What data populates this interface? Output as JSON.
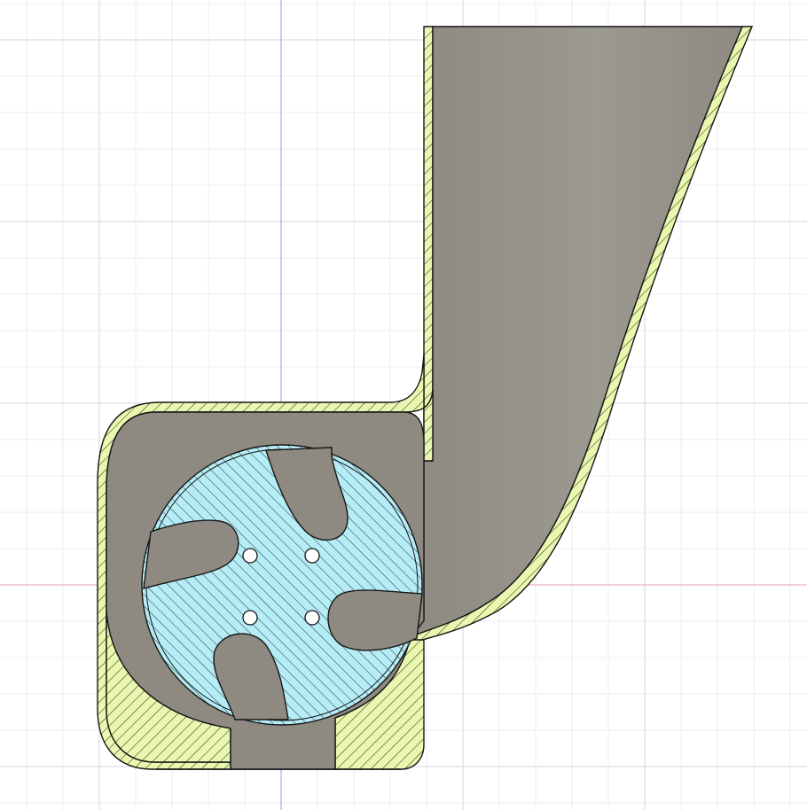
{
  "colors": {
    "background": "#ffffff",
    "grid_minor": "#ececf0",
    "grid_major": "#d4d4dc",
    "axis_vertical": "#9a9ae8",
    "axis_horizontal": "#e6a3b8",
    "section_fill_yellow": "#eaf7b0",
    "section_hatch_yellow": "#2e3a10",
    "section_fill_cyan": "#b5ecf5",
    "section_hatch_cyan": "#203a40",
    "body_gray": "#8e8a82",
    "body_gray_light": "#9c9990",
    "outline": "#151515",
    "hole_fill": "#ffffff"
  },
  "parts": {
    "housing": "fan-housing-section",
    "duct": "outlet-duct",
    "impeller": "impeller-section",
    "blade_count": 4,
    "hole_count": 4
  }
}
